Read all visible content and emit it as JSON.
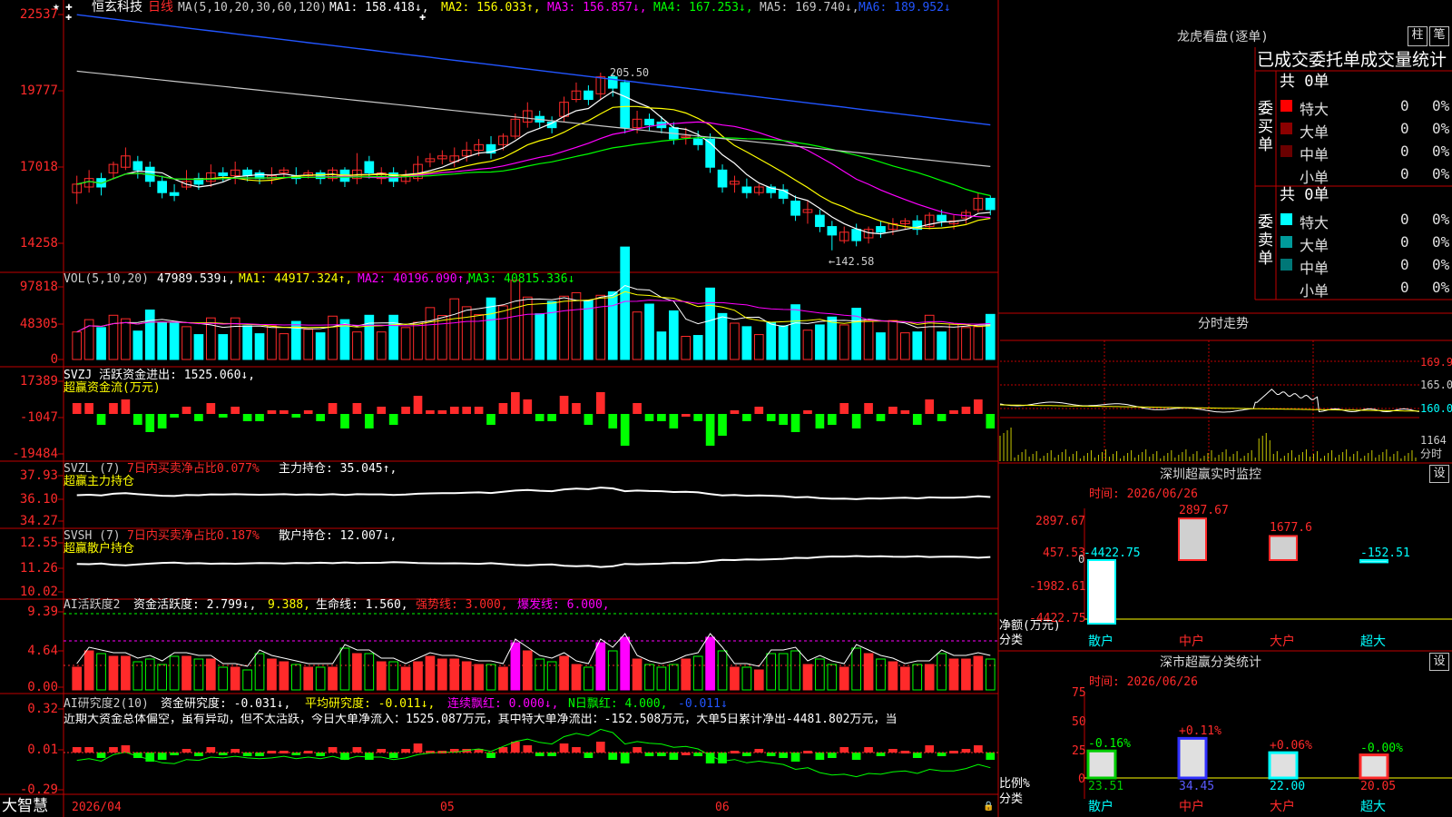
{
  "brand": "大智慧",
  "stock": {
    "name": "恒玄科技",
    "period": "日线"
  },
  "colors": {
    "up": "#ff2a2a",
    "down": "#00ffff",
    "grid": "#c00000",
    "yellow": "#ffff00",
    "magenta": "#ff00ff",
    "green": "#00ff00",
    "white": "#ffffff",
    "blue": "#2255ff"
  },
  "price_panel": {
    "ma_label": "MA(5,10,20,30,60,120)",
    "ma1": "MA1: 158.418↓,",
    "ma2": "MA2: 156.033↑,",
    "ma3": "MA3: 156.857↓,",
    "ma4": "MA4: 167.253↓,",
    "ma5": "MA5: 169.740↓,",
    "ma6": "MA6: 189.952↓",
    "y_ticks": [
      "22537",
      "19777",
      "17018",
      "14258"
    ],
    "high_note": "205.50",
    "low_note": "←142.58"
  },
  "vol_panel": {
    "label": "VOL(5,10,20)",
    "v": "47989.539↓,",
    "ma1": "MA1: 44917.324↑,",
    "ma2": "MA2: 40196.090↑,",
    "ma3": "MA3: 40815.336↓",
    "y_ticks": [
      "97818",
      "48305",
      "0"
    ]
  },
  "svzj_panel": {
    "label": "SVZJ  活跃资金进出: 1525.060↓,",
    "sub": "超赢资金流(万元)",
    "y_ticks": [
      "17389",
      "-1047",
      "-19484"
    ]
  },
  "svzl_panel": {
    "label_a": "SVZL (7)",
    "label_b": "7日内买卖净占比0.077%",
    "label_c": "主力持仓: 35.045↑,",
    "sub": "超赢主力持仓",
    "y_ticks": [
      "37.93",
      "36.10",
      "34.27"
    ]
  },
  "svsh_panel": {
    "label_a": "SVSH (7)",
    "label_b": "7日内买卖净占比0.187%",
    "label_c": "散户持仓: 12.007↓,",
    "sub": "超赢散户持仓",
    "y_ticks": [
      "12.55",
      "11.26",
      "10.02"
    ]
  },
  "ai_act_panel": {
    "label_a": "AI活跃度2",
    "label_b": "资金活跃度: 2.799↓,",
    "label_c": "9.388,",
    "label_d": "生命线: 1.560,",
    "label_e": "强势线: 3.000,",
    "label_f": "爆发线: 6.000,",
    "y_ticks": [
      "9.39",
      "4.64",
      "0.00"
    ]
  },
  "ai_res_panel": {
    "label_a": "AI研究度2(10)",
    "label_b": "资金研究度: -0.031↓,",
    "label_c": "平均研究度: -0.011↓,",
    "label_d": "连续飘红: 0.000↓,",
    "label_e": "N日飘红: 4.000,",
    "label_f": "-0.011↓",
    "summary": "近期大资金总体偏空，虽有异动，但不太活跃，今日大单净流入：1525.087万元，其中特大单净流出：-152.508万元，大单5日累计净出-4481.802万元，当",
    "y_ticks": [
      "0.32",
      "0.01",
      "-0.29"
    ]
  },
  "x_axis": [
    "2026/04",
    "05",
    "06"
  ],
  "right": {
    "lhb_title": "龙虎看盘(逐单)",
    "btn_zhu": "柱",
    "btn_bi": "笔",
    "order_title": "已成交委托单成交量统计",
    "buy_label": "委买单",
    "sell_label": "委卖单",
    "buy_total": "共 0单",
    "sell_total": "共 0单",
    "buy_rows": [
      {
        "name": "特大",
        "num": "0",
        "pct": "0%",
        "color": "#ff0000"
      },
      {
        "name": "大单",
        "num": "0",
        "pct": "0%",
        "color": "#8b0000"
      },
      {
        "name": "中单",
        "num": "0",
        "pct": "0%",
        "color": "#6a0000"
      },
      {
        "name": "小单",
        "num": "0",
        "pct": "0%",
        "color": "#000000"
      }
    ],
    "sell_rows": [
      {
        "name": "特大",
        "num": "0",
        "pct": "0%",
        "color": "#00ffff"
      },
      {
        "name": "大单",
        "num": "0",
        "pct": "0%",
        "color": "#009a9a"
      },
      {
        "name": "中单",
        "num": "0",
        "pct": "0%",
        "color": "#007777"
      },
      {
        "name": "小单",
        "num": "0",
        "pct": "0%",
        "color": "#000000"
      }
    ],
    "intraday_title": "分时走势",
    "intraday_ticks": [
      "169.9",
      "165.0",
      "160.0",
      "1164"
    ],
    "intraday_x": "分时",
    "sz_title": "深圳超赢实时监控",
    "btn_set1": "设",
    "sz_time": "时间: 2026/06/26",
    "sz_ticks": [
      "2897.67",
      "457.53",
      "-1982.61",
      "-4422.75"
    ],
    "sz_zero": "0",
    "sz_unit": "净额(万元)",
    "sz_cat": "分类",
    "sz_bars": [
      {
        "label": "散户",
        "value": -4422.75,
        "text": "-4422.75"
      },
      {
        "label": "中户",
        "value": 2897.67,
        "text": "2897.67"
      },
      {
        "label": "大户",
        "value": 1677.6,
        "text": "1677.6"
      },
      {
        "label": "超大",
        "value": -152.51,
        "text": "-152.51"
      }
    ],
    "cls_title": "深市超赢分类统计",
    "btn_set2": "设",
    "cls_time": "时间: 2026/06/26",
    "cls_ticks": [
      "75",
      "50",
      "25",
      "0"
    ],
    "cls_unit": "比例%",
    "cls_cat": "分类",
    "cls_bars": [
      {
        "label": "散户",
        "value": 23.51,
        "text": "23.51",
        "chg": "-0.16%"
      },
      {
        "label": "中户",
        "value": 34.45,
        "text": "34.45",
        "chg": "+0.11%"
      },
      {
        "label": "大户",
        "value": 22.0,
        "text": "22.00",
        "chg": "+0.06%"
      },
      {
        "label": "超大",
        "value": 20.05,
        "text": "20.05",
        "chg": "-0.00%"
      }
    ]
  },
  "chart_data": {
    "type": "candlestick",
    "candles": [
      [
        163,
        166,
        159,
        169
      ],
      [
        165,
        168,
        163,
        171
      ],
      [
        168,
        165,
        162,
        170
      ],
      [
        170,
        173,
        168,
        174
      ],
      [
        172,
        176,
        171,
        179
      ],
      [
        174,
        171,
        168,
        176
      ],
      [
        172,
        167,
        165,
        174
      ],
      [
        167,
        163,
        161,
        169
      ],
      [
        163,
        162,
        160,
        166
      ],
      [
        165,
        167,
        164,
        171
      ],
      [
        168,
        166,
        164,
        170
      ],
      [
        167,
        170,
        165,
        173
      ],
      [
        170,
        169,
        167,
        172
      ],
      [
        169,
        171,
        166,
        174
      ],
      [
        171,
        169,
        167,
        172
      ],
      [
        170,
        168,
        166,
        171
      ],
      [
        168,
        169,
        166,
        172
      ],
      [
        170,
        171,
        168,
        172
      ],
      [
        169,
        168,
        166,
        172
      ],
      [
        169,
        170,
        168,
        171
      ],
      [
        170,
        168,
        166,
        171
      ],
      [
        168,
        171,
        167,
        172
      ],
      [
        171,
        167,
        165,
        172
      ],
      [
        168,
        171,
        166,
        177
      ],
      [
        174,
        170,
        168,
        176
      ],
      [
        168,
        170,
        166,
        172
      ],
      [
        170,
        167,
        165,
        172
      ],
      [
        167,
        169,
        166,
        171
      ],
      [
        168,
        173,
        167,
        176
      ],
      [
        174,
        175,
        172,
        177
      ],
      [
        175,
        176,
        173,
        178
      ],
      [
        174,
        176,
        172,
        179
      ],
      [
        176,
        178,
        174,
        181
      ],
      [
        178,
        180,
        176,
        182
      ],
      [
        180,
        177,
        175,
        183
      ],
      [
        180,
        183,
        178,
        184
      ],
      [
        183,
        189,
        182,
        191
      ],
      [
        188,
        192,
        186,
        195
      ],
      [
        190,
        188,
        186,
        192
      ],
      [
        188,
        186,
        184,
        190
      ],
      [
        190,
        195,
        188,
        197
      ],
      [
        196,
        199,
        195,
        202
      ],
      [
        199,
        196,
        194,
        201
      ],
      [
        198,
        204,
        196,
        205.5
      ],
      [
        204,
        200,
        197,
        205
      ],
      [
        202,
        186,
        184,
        203
      ],
      [
        186,
        189,
        184,
        192
      ],
      [
        189,
        187,
        185,
        191
      ],
      [
        188,
        186,
        184,
        190
      ],
      [
        186,
        182,
        180,
        188
      ],
      [
        183,
        183,
        180,
        186
      ],
      [
        182,
        180,
        178,
        185
      ],
      [
        182,
        172,
        170,
        184
      ],
      [
        171,
        165,
        163,
        173
      ],
      [
        166,
        167,
        163,
        169
      ],
      [
        165,
        163,
        161,
        168
      ],
      [
        163,
        165,
        162,
        166
      ],
      [
        165,
        163,
        161,
        166
      ],
      [
        164,
        161,
        159,
        166
      ],
      [
        160,
        155,
        153,
        162
      ],
      [
        156,
        157,
        152,
        160
      ],
      [
        155,
        151,
        149,
        157
      ],
      [
        151,
        148,
        142.58,
        153
      ],
      [
        146,
        149,
        145,
        151
      ],
      [
        150,
        146,
        144,
        152
      ],
      [
        147,
        150,
        145,
        151
      ],
      [
        151,
        149,
        147,
        153
      ],
      [
        150,
        152,
        148,
        154
      ],
      [
        152,
        153,
        150,
        154
      ],
      [
        153,
        150,
        148,
        155
      ],
      [
        151,
        155,
        150,
        156
      ],
      [
        155,
        153,
        151,
        157
      ],
      [
        152,
        153,
        150,
        155
      ],
      [
        154,
        156,
        152,
        157
      ],
      [
        157,
        161,
        156,
        163
      ],
      [
        161,
        157,
        155,
        162
      ]
    ]
  }
}
